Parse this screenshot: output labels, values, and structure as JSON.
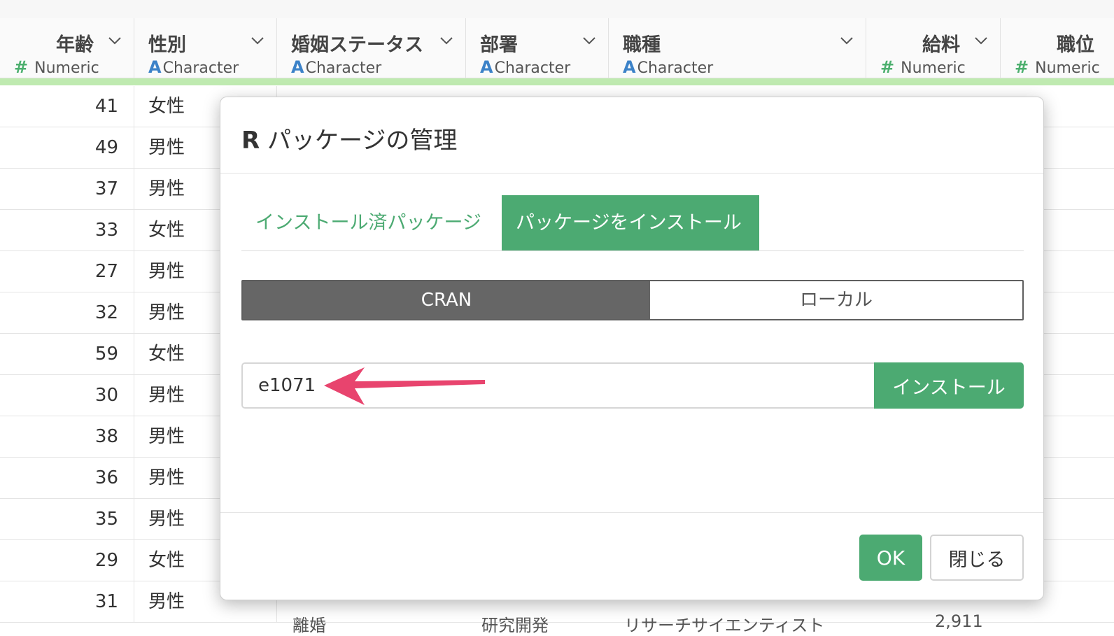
{
  "columns": [
    {
      "name": "年齢",
      "type_symbol": "#",
      "type": "Numeric"
    },
    {
      "name": "性別",
      "type_symbol": "A",
      "type": "Character"
    },
    {
      "name": "婚姻ステータス",
      "type_symbol": "A",
      "type": "Character"
    },
    {
      "name": "部署",
      "type_symbol": "A",
      "type": "Character"
    },
    {
      "name": "職種",
      "type_symbol": "A",
      "type": "Character"
    },
    {
      "name": "給料",
      "type_symbol": "#",
      "type": "Numeric"
    },
    {
      "name": "職位",
      "type_symbol": "#",
      "type": "Numeric"
    }
  ],
  "rows": [
    {
      "age": "41",
      "gender": "女性"
    },
    {
      "age": "49",
      "gender": "男性"
    },
    {
      "age": "37",
      "gender": "男性"
    },
    {
      "age": "33",
      "gender": "女性"
    },
    {
      "age": "27",
      "gender": "男性"
    },
    {
      "age": "32",
      "gender": "男性"
    },
    {
      "age": "59",
      "gender": "女性"
    },
    {
      "age": "30",
      "gender": "男性"
    },
    {
      "age": "38",
      "gender": "男性"
    },
    {
      "age": "36",
      "gender": "男性"
    },
    {
      "age": "35",
      "gender": "男性"
    },
    {
      "age": "29",
      "gender": "女性"
    },
    {
      "age": "31",
      "gender": "男性"
    }
  ],
  "partial_last_row": {
    "marital": "離婚",
    "department": "研究開発",
    "job": "リサーチサイエンティスト",
    "salary": "2,911"
  },
  "modal": {
    "title_prefix": "R",
    "title": "パッケージの管理",
    "tabs": {
      "installed": "インストール済パッケージ",
      "install": "パッケージをインストール"
    },
    "source": {
      "cran": "CRAN",
      "local": "ローカル"
    },
    "package_input_value": "e1071",
    "install_button": "インストール",
    "ok_button": "OK",
    "close_button": "閉じる"
  },
  "colors": {
    "accent_green": "#4caa72",
    "quality_bar": "#bfeab0",
    "numeric_icon": "#4caf6e",
    "character_icon": "#3c82c8",
    "annotation_arrow": "#e8446e",
    "segment_active": "#666666"
  },
  "icons": {
    "column_menu": "chevron-down-icon",
    "annotation": "arrow-left-icon"
  }
}
